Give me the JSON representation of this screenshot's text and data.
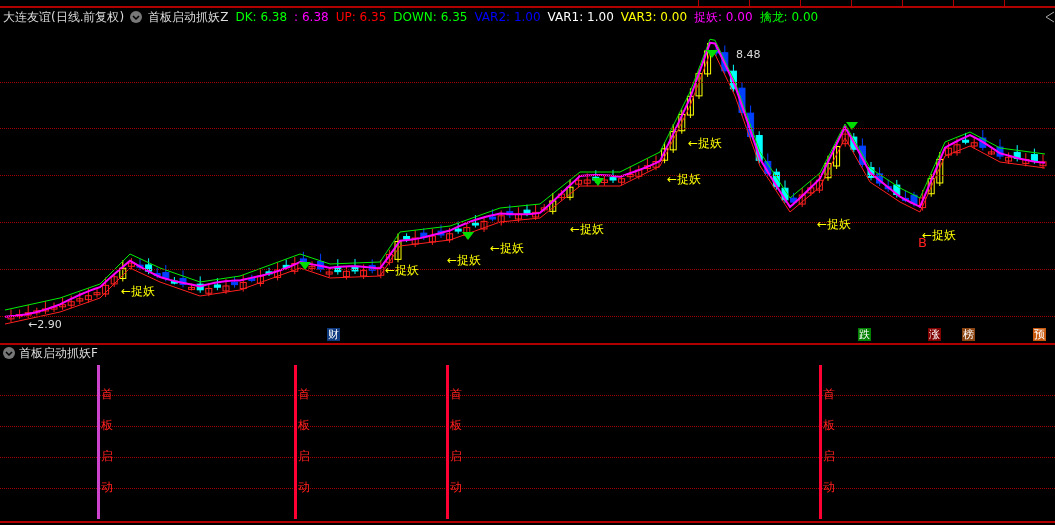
{
  "header": {
    "stock": "大连友谊(日线.前复权)",
    "indicator": "首板启动抓妖Z",
    "values": [
      {
        "text": "DK: 6.38",
        "color": "#00ff00"
      },
      {
        "text": ": 6.38",
        "color": "#ff00ff"
      },
      {
        "text": "UP: 6.35",
        "color": "#ff0000"
      },
      {
        "text": "DOWN: 6.35",
        "color": "#00ff00"
      },
      {
        "text": "VAR2: 1.00",
        "color": "#0000ff"
      },
      {
        "text": "VAR1: 1.00",
        "color": "#ffffff"
      },
      {
        "text": "VAR3: 0.00",
        "color": "#ffff00"
      },
      {
        "text": "捉妖: 0.00",
        "color": "#ff00ff"
      },
      {
        "text": "擒龙: 0.00",
        "color": "#00ff00"
      }
    ]
  },
  "chart": {
    "labels": [
      {
        "text": "←捉妖"
      },
      {
        "text": "←捉妖"
      },
      {
        "text": "←捉妖"
      },
      {
        "text": "←捉妖"
      },
      {
        "text": "←捉妖"
      },
      {
        "text": "←捉妖"
      },
      {
        "text": "←捉妖"
      },
      {
        "text": "←捉妖"
      },
      {
        "text": "←捉妖"
      }
    ],
    "high_mark": "8.48",
    "low_mark": "←2.90",
    "signal": "B",
    "tags": [
      {
        "text": "财",
        "color": "#103a80"
      },
      {
        "text": "跌",
        "color": "#008000"
      },
      {
        "text": "涨",
        "color": "#800000"
      },
      {
        "text": "榜",
        "color": "#8b4513"
      },
      {
        "text": "预",
        "color": "#c85a10"
      }
    ]
  },
  "panel": {
    "indicator": "首板启动抓妖F",
    "signals": [
      {
        "text": "首板启动",
        "color": "#cc44cc"
      },
      {
        "text": "首板启动",
        "color": "#ff0033"
      },
      {
        "text": "首板启动",
        "color": "#ff0033"
      },
      {
        "text": "首板启动",
        "color": "#ff0033"
      }
    ]
  }
}
